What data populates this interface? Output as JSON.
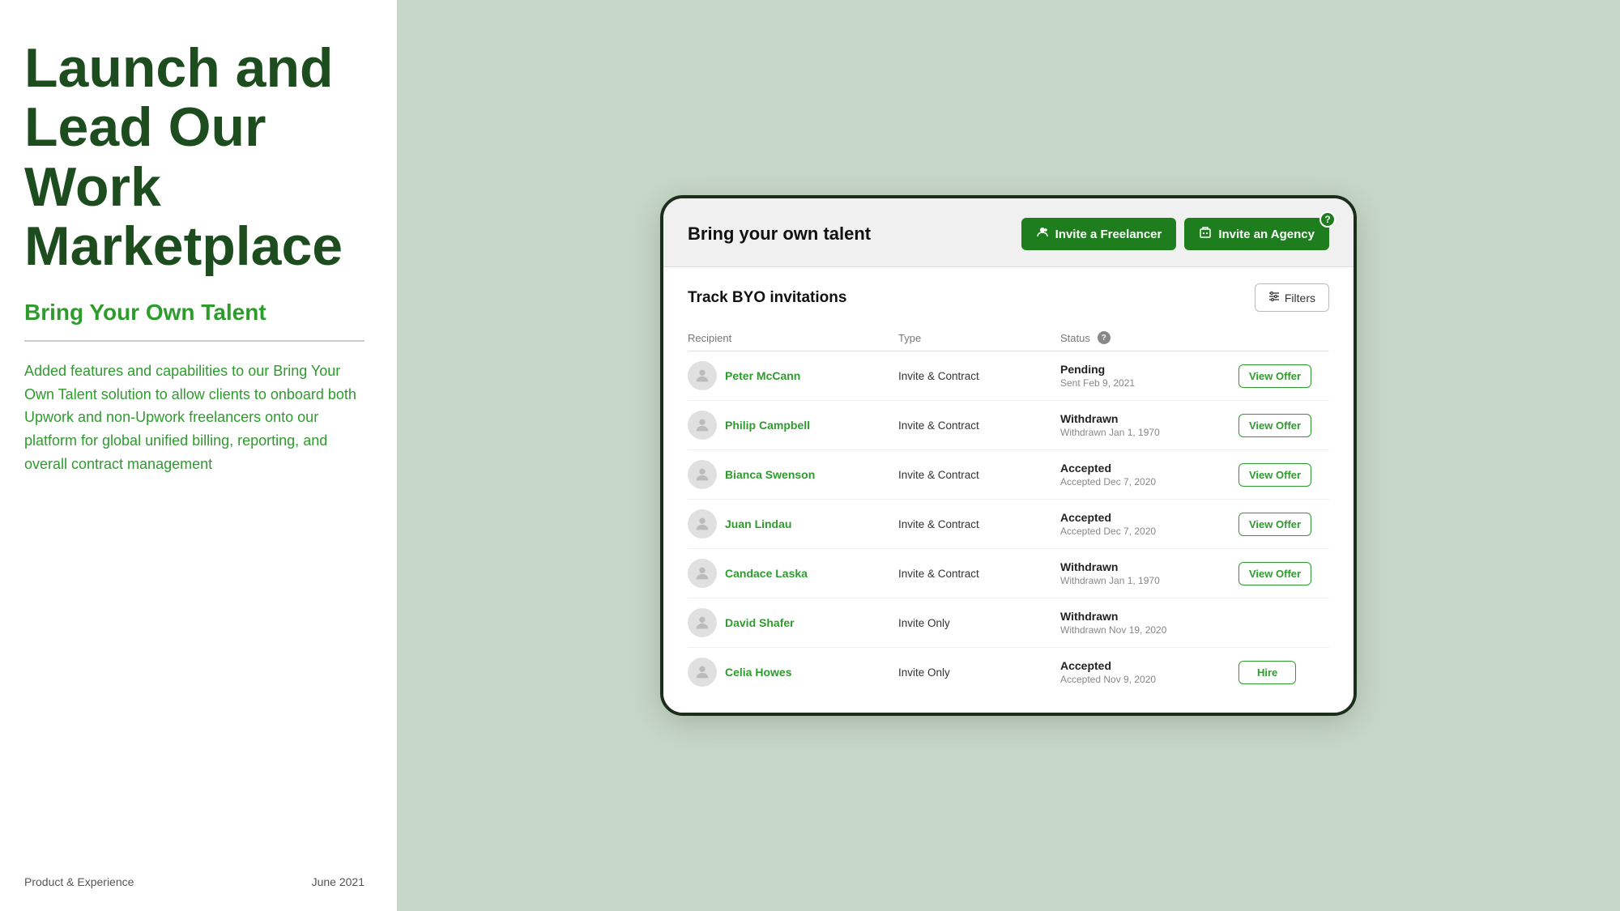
{
  "left": {
    "main_title": "Launch and Lead Our Work Marketplace",
    "subtitle": "Bring Your Own Talent",
    "description": "Added features and capabilities to our Bring Your Own Talent solution to allow clients to onboard both Upwork and non-Upwork freelancers onto our platform for global unified billing, reporting, and overall contract management",
    "footer_left": "Product & Experience",
    "footer_right": "June 2021"
  },
  "card": {
    "header_title": "Bring your own talent",
    "invite_freelancer_label": "Invite a Freelancer",
    "invite_agency_label": "Invite an Agency",
    "help_badge": "?",
    "track_title": "Track BYO invitations",
    "filters_label": "Filters",
    "table": {
      "columns": [
        "Recipient",
        "Type",
        "Status",
        "",
        ""
      ],
      "status_help": "?",
      "rows": [
        {
          "name": "Peter McCann",
          "type": "Invite & Contract",
          "status": "Pending",
          "status_date": "Sent Feb 9, 2021",
          "action": "View Offer"
        },
        {
          "name": "Philip Campbell",
          "type": "Invite & Contract",
          "status": "Withdrawn",
          "status_date": "Withdrawn Jan 1, 1970",
          "action": "View Offer"
        },
        {
          "name": "Bianca Swenson",
          "type": "Invite & Contract",
          "status": "Accepted",
          "status_date": "Accepted Dec 7, 2020",
          "action": "View Offer"
        },
        {
          "name": "Juan Lindau",
          "type": "Invite & Contract",
          "status": "Accepted",
          "status_date": "Accepted Dec 7, 2020",
          "action": "View Offer"
        },
        {
          "name": "Candace Laska",
          "type": "Invite & Contract",
          "status": "Withdrawn",
          "status_date": "Withdrawn Jan 1, 1970",
          "action": "View Offer"
        },
        {
          "name": "David Shafer",
          "type": "Invite Only",
          "status": "Withdrawn",
          "status_date": "Withdrawn Nov 19, 2020",
          "action": null
        },
        {
          "name": "Celia Howes",
          "type": "Invite Only",
          "status": "Accepted",
          "status_date": "Accepted Nov 9, 2020",
          "action": "Hire"
        }
      ]
    }
  }
}
